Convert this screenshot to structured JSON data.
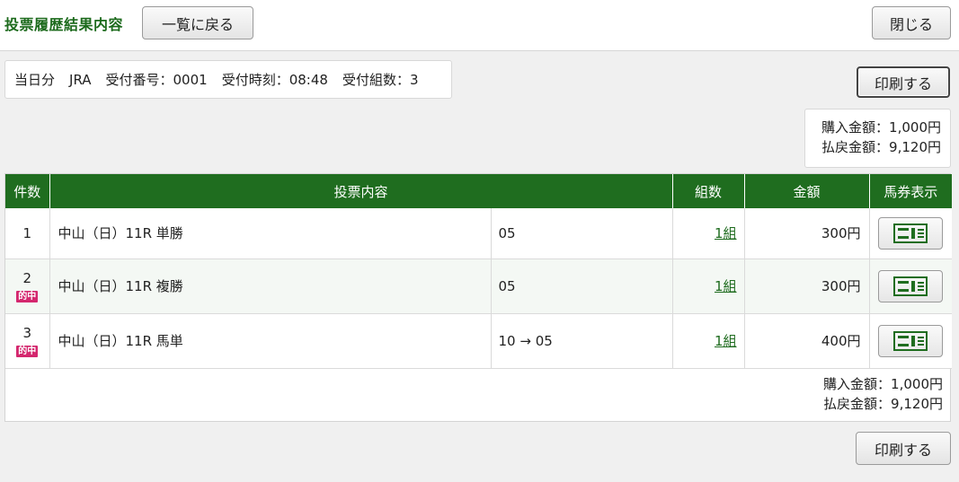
{
  "header": {
    "title": "投票履歴結果内容",
    "back_label": "一覧に戻る",
    "close_label": "閉じる"
  },
  "info": {
    "day": "当日分",
    "org": "JRA",
    "receipt_no": "受付番号：0001",
    "receipt_time": "受付時刻：08:48",
    "receipt_count": "受付組数：3"
  },
  "print_label": "印刷する",
  "summary": {
    "purchase": "購入金額：1,000円",
    "refund": "払戻金額：9,120円"
  },
  "table": {
    "headers": {
      "count": "件数",
      "content": "投票内容",
      "kumi": "組数",
      "amount": "金額",
      "ticket": "馬券表示"
    },
    "hit_label": "的中",
    "rows": [
      {
        "no": "1",
        "race": "中山（日）11R 単勝",
        "selection": "05",
        "kumi": "1組",
        "amount": "300円"
      },
      {
        "no": "2",
        "race": "中山（日）11R 複勝",
        "selection": "05",
        "kumi": "1組",
        "amount": "300円"
      },
      {
        "no": "3",
        "race": "中山（日）11R 馬単",
        "selection": "10 → 05",
        "kumi": "1組",
        "amount": "400円"
      }
    ]
  },
  "icons": {
    "ticket": "ticket-icon"
  },
  "colors": {
    "accent_green": "#1f6d1f",
    "hit_badge": "#d4276e"
  }
}
